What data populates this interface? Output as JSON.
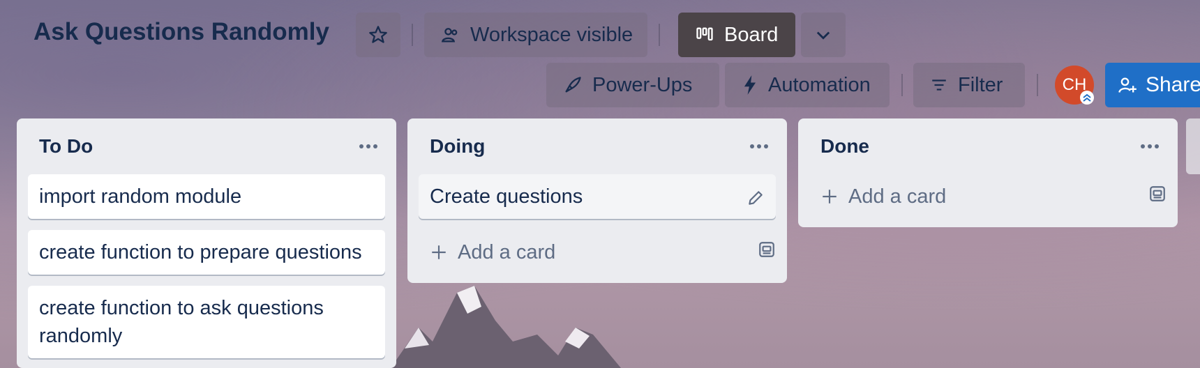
{
  "board": {
    "title": "Ask Questions Randomly",
    "visibility_label": "Workspace visible",
    "view_label": "Board"
  },
  "toolbar": {
    "powerups_label": "Power-Ups",
    "automation_label": "Automation",
    "filter_label": "Filter",
    "share_label": "Share",
    "avatar_initials": "CH"
  },
  "colors": {
    "text": "#172b4d",
    "list_bg": "#ebecf0",
    "share_bg": "#1f6fc7",
    "avatar_bg": "#d24a2a",
    "board_btn_bg": "#4b4448"
  },
  "lists": [
    {
      "title": "To Do",
      "cards": [
        "import random module",
        "create function to prepare questions",
        "create function to ask questions randomly"
      ]
    },
    {
      "title": "Doing",
      "cards": [
        "Create questions"
      ],
      "add_card_label": "Add a card"
    },
    {
      "title": "Done",
      "cards": [],
      "add_card_label": "Add a card"
    }
  ]
}
